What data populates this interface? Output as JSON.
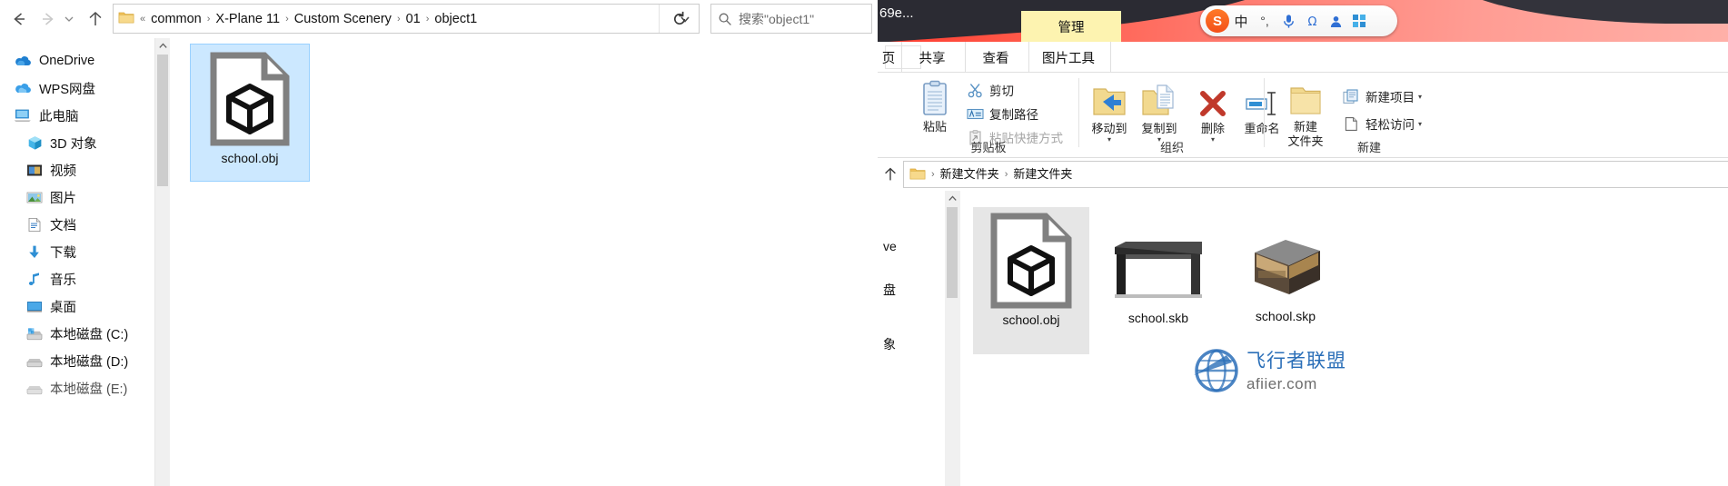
{
  "left_window": {
    "nav_buttons": [
      {
        "name": "back",
        "label": "←",
        "enabled": true
      },
      {
        "name": "forward",
        "label": "→",
        "enabled": false
      },
      {
        "name": "recent-locations",
        "label": "⌄",
        "enabled": true
      },
      {
        "name": "up",
        "label": "↑",
        "enabled": true
      }
    ],
    "address": {
      "prefix": "«",
      "crumbs": [
        "common",
        "X-Plane 11",
        "Custom Scenery",
        "01",
        "object1"
      ],
      "separator": "›",
      "chevron": "⌄",
      "refresh": "↻"
    },
    "search": {
      "placeholder": "搜索\"object1\"",
      "value": ""
    },
    "nav_pane": [
      {
        "label": "OneDrive",
        "icon": "onedrive-cloud-icon",
        "indent": false
      },
      {
        "label": "WPS网盘",
        "icon": "wps-cloud-icon",
        "indent": false
      },
      {
        "label": "此电脑",
        "icon": "this-pc-icon",
        "indent": false
      },
      {
        "label": "3D 对象",
        "icon": "3d-objects-icon",
        "indent": true
      },
      {
        "label": "视频",
        "icon": "videos-icon",
        "indent": true
      },
      {
        "label": "图片",
        "icon": "pictures-icon",
        "indent": true
      },
      {
        "label": "文档",
        "icon": "documents-icon",
        "indent": true
      },
      {
        "label": "下载",
        "icon": "downloads-icon",
        "indent": true
      },
      {
        "label": "音乐",
        "icon": "music-icon",
        "indent": true
      },
      {
        "label": "桌面",
        "icon": "desktop-icon",
        "indent": true
      },
      {
        "label": "本地磁盘 (C:)",
        "icon": "drive-c-icon",
        "indent": true
      },
      {
        "label": "本地磁盘 (D:)",
        "icon": "drive-d-icon",
        "indent": true
      },
      {
        "label": "本地磁盘 (E:)",
        "icon": "drive-e-icon",
        "indent": true
      }
    ],
    "files": [
      {
        "name": "school.obj",
        "icon": "obj-3d-file-icon",
        "selected": true
      }
    ]
  },
  "right_window": {
    "wallpaper_title": "69e...",
    "ime": {
      "logo": "S",
      "items": [
        "中",
        "°,",
        "mic-icon",
        "omega-icon",
        "user-icon",
        "grid-icon"
      ]
    },
    "tabs": {
      "home_partial": "页",
      "items": [
        "共享",
        "查看"
      ],
      "contextual_group": "图片工具",
      "contextual_tab": "管理"
    },
    "ribbon": {
      "groups": [
        {
          "label": "剪贴板",
          "big_buttons": [
            {
              "label": "粘贴",
              "icon": "clipboard-icon",
              "caret": false
            }
          ],
          "small_buttons": [
            {
              "label": "剪切",
              "icon": "scissors-icon",
              "dim": false
            },
            {
              "label": "复制路径",
              "icon": "copy-path-icon",
              "dim": false
            },
            {
              "label": "粘贴快捷方式",
              "icon": "paste-shortcut-icon",
              "dim": true
            }
          ]
        },
        {
          "label": "组织",
          "big_buttons": [
            {
              "label": "移动到",
              "icon": "move-to-icon",
              "caret": true
            },
            {
              "label": "复制到",
              "icon": "copy-to-icon",
              "caret": true
            },
            {
              "label": "删除",
              "icon": "delete-x-icon",
              "caret": true
            },
            {
              "label": "重命名",
              "icon": "rename-icon",
              "caret": false
            }
          ],
          "small_buttons": []
        },
        {
          "label": "新建",
          "big_buttons": [
            {
              "label": "新建\n文件夹",
              "label_line1": "新建",
              "label_line2": "文件夹",
              "icon": "new-folder-icon",
              "caret": false
            }
          ],
          "small_buttons": [
            {
              "label": "新建项目",
              "icon": "new-item-icon",
              "dim": false,
              "caret": true
            },
            {
              "label": "轻松访问",
              "icon": "easy-access-icon",
              "dim": false,
              "caret": true
            }
          ]
        }
      ]
    },
    "address": {
      "up": "↑",
      "crumbs": [
        "新建文件夹",
        "新建文件夹"
      ],
      "separator": "›"
    },
    "nav_pane": [
      {
        "label": "ve"
      },
      {
        "label": "盘"
      },
      {
        "label": "象"
      }
    ],
    "files": [
      {
        "name": "school.obj",
        "icon": "obj-3d-file-icon",
        "selected": true
      },
      {
        "name": "school.skb",
        "icon": "skb-thumbnail",
        "selected": false
      },
      {
        "name": "school.skp",
        "icon": "skp-thumbnail",
        "selected": false
      }
    ]
  },
  "watermark": {
    "text_cn": "飞行者联盟",
    "text_en": "afiier.com",
    "icon": "globe-icon"
  },
  "colors": {
    "selection_blue": "#cce8ff",
    "selection_border": "#99d1ff",
    "contextual_yellow": "#fdf3b0",
    "wallpaper_red": "#ff5a4a",
    "folder_yellow": "#f5d17a",
    "delete_red": "#c0392b",
    "watermark_blue": "#2b6fb8"
  }
}
